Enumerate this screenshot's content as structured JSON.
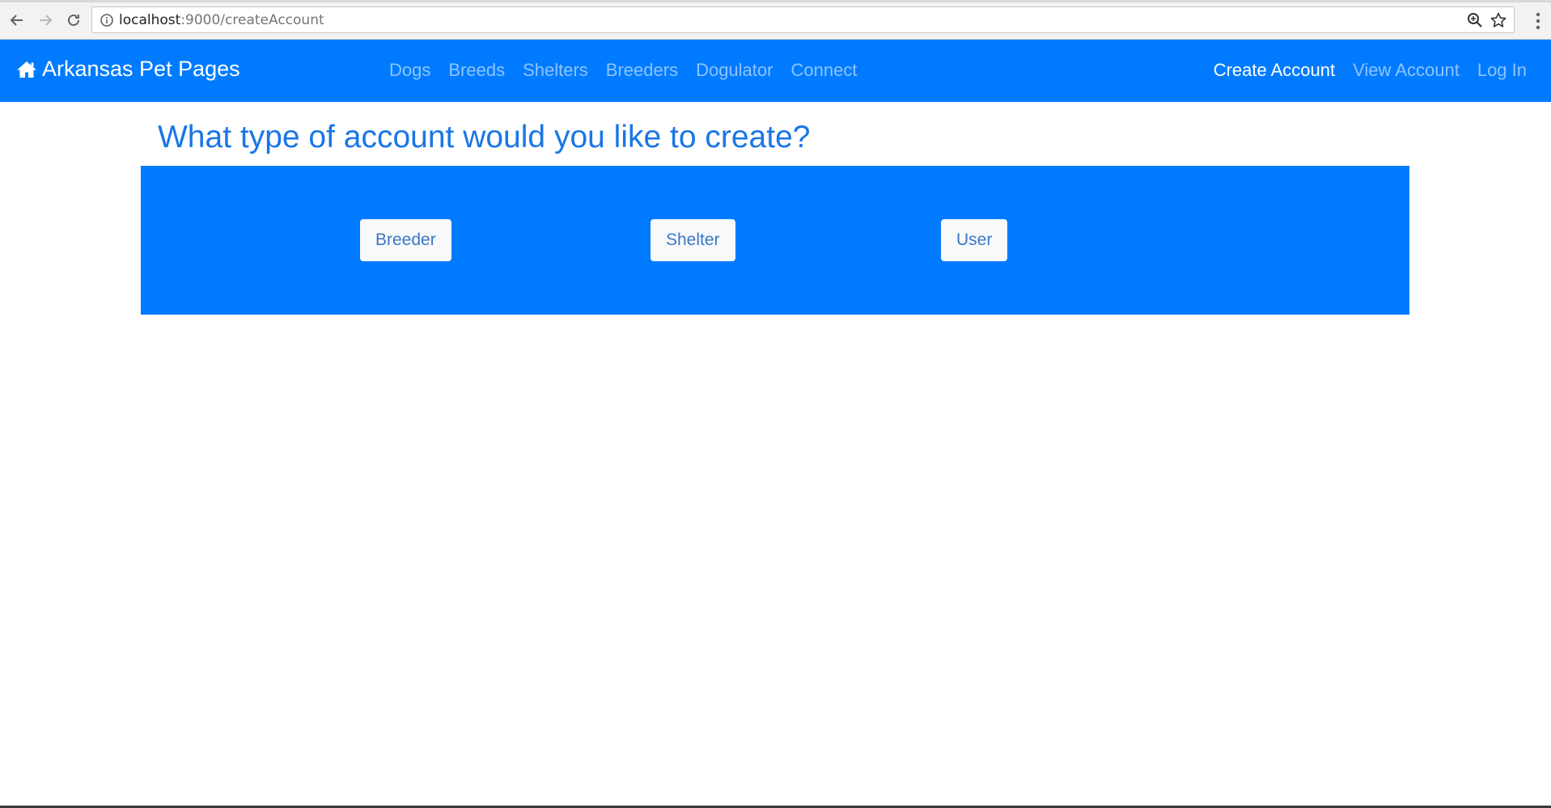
{
  "browser": {
    "url_host": "localhost",
    "url_path": ":9000/createAccount"
  },
  "navbar": {
    "brand": "Arkansas Pet Pages",
    "links": [
      "Dogs",
      "Breeds",
      "Shelters",
      "Breeders",
      "Dogulator",
      "Connect"
    ],
    "right_links": [
      "Create Account",
      "View Account",
      "Log In"
    ],
    "active": "Create Account"
  },
  "main": {
    "title": "What type of account would you like to create?",
    "options": [
      "Breeder",
      "Shelter",
      "User"
    ]
  },
  "colors": {
    "primary": "#007bff",
    "title": "#1976e6",
    "button_bg": "#f8f9fa",
    "button_text": "#3a77c4"
  },
  "icons": {
    "brand": "home-icon",
    "back": "back-arrow-icon",
    "forward": "forward-arrow-icon",
    "reload": "reload-icon",
    "site_info": "info-icon",
    "zoom": "zoom-icon",
    "bookmark": "star-icon",
    "menu": "kebab-menu-icon"
  }
}
